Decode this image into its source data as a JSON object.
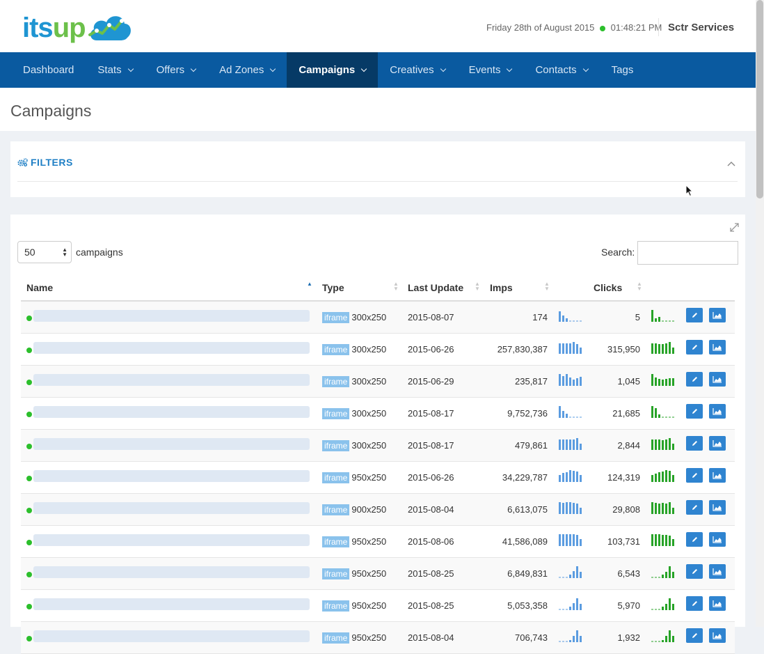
{
  "brand": {
    "logo_text_a": "its",
    "logo_text_b": "up"
  },
  "header": {
    "date": "Friday 28th of August 2015",
    "time": "01:48:21 PM",
    "user": "Sctr Services"
  },
  "nav": [
    {
      "label": "Dashboard",
      "caret": false,
      "active": false
    },
    {
      "label": "Stats",
      "caret": true,
      "active": false
    },
    {
      "label": "Offers",
      "caret": true,
      "active": false
    },
    {
      "label": "Ad Zones",
      "caret": true,
      "active": false
    },
    {
      "label": "Campaigns",
      "caret": true,
      "active": true
    },
    {
      "label": "Creatives",
      "caret": true,
      "active": false
    },
    {
      "label": "Events",
      "caret": true,
      "active": false
    },
    {
      "label": "Contacts",
      "caret": true,
      "active": false
    },
    {
      "label": "Tags",
      "caret": false,
      "active": false
    }
  ],
  "page": {
    "title": "Campaigns"
  },
  "filters": {
    "title": "FILTERS"
  },
  "table": {
    "length_value": "50",
    "length_label": "campaigns",
    "search_label": "Search:",
    "columns": {
      "name": "Name",
      "type": "Type",
      "last_update": "Last Update",
      "imps": "Imps",
      "clicks": "Clicks"
    },
    "rows": [
      {
        "type_badge": "iframe",
        "size": "300x250",
        "last_update": "2015-08-07",
        "imps": "174",
        "clicks": "5",
        "imps_spark": [
          0.9,
          0.5,
          0.3,
          0.05,
          0.05,
          0.05,
          0.05
        ],
        "clicks_spark": [
          1,
          0.3,
          0.4,
          0.05,
          0.05,
          0.05,
          0.05
        ]
      },
      {
        "type_badge": "iframe",
        "size": "300x250",
        "last_update": "2015-06-26",
        "imps": "257,830,387",
        "clicks": "315,950",
        "imps_spark": [
          0.9,
          0.9,
          0.9,
          0.9,
          1,
          0.85,
          0.5
        ],
        "clicks_spark": [
          0.9,
          0.9,
          0.85,
          0.8,
          0.9,
          1,
          0.5
        ]
      },
      {
        "type_badge": "iframe",
        "size": "300x250",
        "last_update": "2015-06-29",
        "imps": "235,817",
        "clicks": "1,045",
        "imps_spark": [
          1,
          0.8,
          1,
          0.7,
          0.55,
          0.65,
          0.75
        ],
        "clicks_spark": [
          1,
          0.7,
          0.6,
          0.5,
          0.6,
          0.65,
          0.65
        ]
      },
      {
        "type_badge": "iframe",
        "size": "300x250",
        "last_update": "2015-08-17",
        "imps": "9,752,736",
        "clicks": "21,685",
        "imps_spark": [
          1,
          0.6,
          0.35,
          0.05,
          0.05,
          0.05,
          0.05
        ],
        "clicks_spark": [
          1,
          0.85,
          0.3,
          0.05,
          0.05,
          0.05,
          0.05
        ]
      },
      {
        "type_badge": "iframe",
        "size": "300x250",
        "last_update": "2015-08-17",
        "imps": "479,861",
        "clicks": "2,844",
        "imps_spark": [
          0.9,
          0.9,
          0.9,
          0.9,
          0.9,
          1,
          0.5
        ],
        "clicks_spark": [
          0.9,
          0.9,
          0.9,
          0.85,
          0.9,
          1,
          0.5
        ]
      },
      {
        "type_badge": "iframe",
        "size": "950x250",
        "last_update": "2015-06-26",
        "imps": "34,229,787",
        "clicks": "124,319",
        "imps_spark": [
          0.6,
          0.75,
          0.85,
          1,
          0.95,
          0.9,
          0.6
        ],
        "clicks_spark": [
          0.6,
          0.7,
          0.8,
          0.9,
          1,
          0.95,
          0.6
        ]
      },
      {
        "type_badge": "iframe",
        "size": "900x250",
        "last_update": "2015-08-04",
        "imps": "6,613,075",
        "clicks": "29,808",
        "imps_spark": [
          1,
          0.95,
          1,
          1,
          0.95,
          0.9,
          0.55
        ],
        "clicks_spark": [
          1,
          0.95,
          0.9,
          0.95,
          0.9,
          1,
          0.55
        ]
      },
      {
        "type_badge": "iframe",
        "size": "950x250",
        "last_update": "2015-08-06",
        "imps": "41,586,089",
        "clicks": "103,731",
        "imps_spark": [
          1,
          1,
          1,
          1,
          1,
          0.95,
          0.6
        ],
        "clicks_spark": [
          1,
          1,
          1,
          0.95,
          0.95,
          0.9,
          0.6
        ]
      },
      {
        "type_badge": "iframe",
        "size": "950x250",
        "last_update": "2015-08-25",
        "imps": "6,849,831",
        "clicks": "6,543",
        "imps_spark": [
          0.05,
          0.05,
          0.05,
          0.3,
          0.6,
          1,
          0.55
        ],
        "clicks_spark": [
          0.05,
          0.05,
          0.05,
          0.3,
          0.5,
          1,
          0.5
        ]
      },
      {
        "type_badge": "iframe",
        "size": "950x250",
        "last_update": "2015-08-25",
        "imps": "5,053,358",
        "clicks": "5,970",
        "imps_spark": [
          0.05,
          0.05,
          0.05,
          0.3,
          0.6,
          1,
          0.55
        ],
        "clicks_spark": [
          0.05,
          0.05,
          0.05,
          0.3,
          0.55,
          1,
          0.5
        ]
      },
      {
        "type_badge": "iframe",
        "size": "950x250",
        "last_update": "2015-08-04",
        "imps": "706,743",
        "clicks": "1,932",
        "imps_spark": [
          0.05,
          0.05,
          0.05,
          0.2,
          0.5,
          1,
          0.5
        ],
        "clicks_spark": [
          0.05,
          0.05,
          0.05,
          0.2,
          0.5,
          1,
          0.5
        ]
      }
    ]
  },
  "colors": {
    "imps_bar": "#5b9ce0",
    "clicks_bar": "#27a327",
    "nav_bg": "#0a5aa0",
    "nav_active": "#063a66",
    "accent": "#1f7fc5"
  },
  "icons": [
    "filters-gears-icon",
    "chevron-up-icon",
    "expand-icon",
    "edit-pencil-icon",
    "chart-area-icon",
    "mouse-cursor-icon"
  ]
}
